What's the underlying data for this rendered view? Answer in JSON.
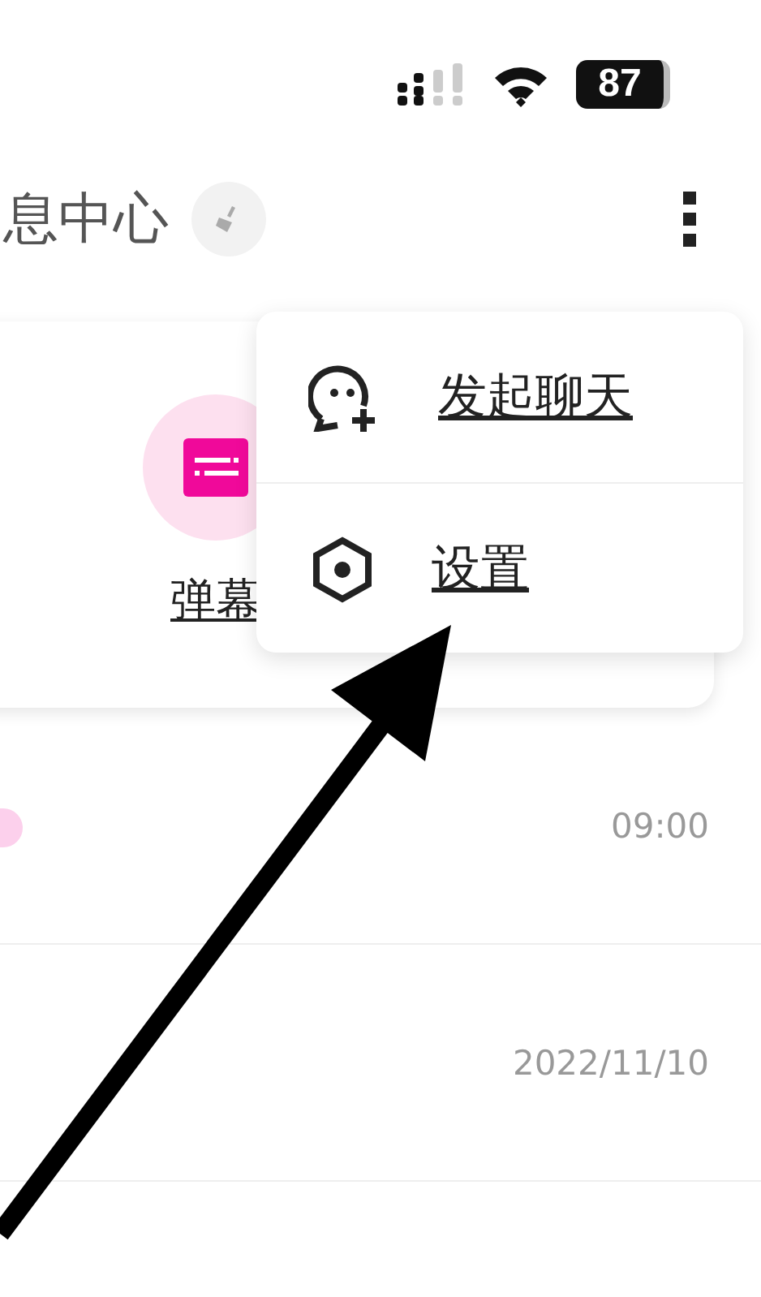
{
  "status_bar": {
    "battery": "87"
  },
  "header": {
    "title": "息中心"
  },
  "shortcuts": [
    {
      "label": "弹幕"
    }
  ],
  "messages": [
    {
      "time": "09:00"
    },
    {
      "time": "2022/11/10"
    }
  ],
  "menu": {
    "items": [
      {
        "label": "发起聊天",
        "kind": "chat"
      },
      {
        "label": "设置",
        "kind": "settings"
      }
    ]
  }
}
